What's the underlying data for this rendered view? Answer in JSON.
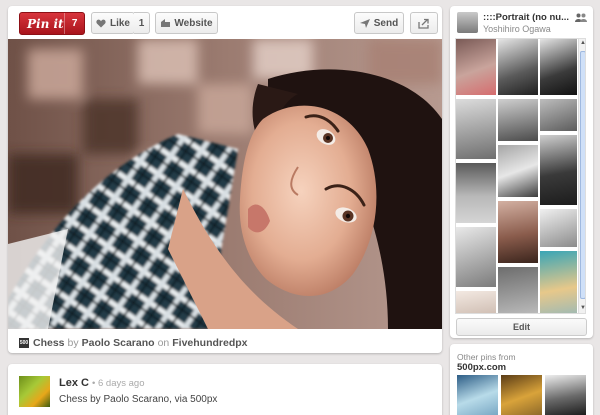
{
  "toolbar": {
    "pinit_label": "Pin it",
    "pinit_count": "7",
    "like_label": "Like",
    "like_count": "1",
    "website_label": "Website",
    "send_label": "Send"
  },
  "caption": {
    "title": "Chess",
    "by": "by",
    "author": "Paolo Scarano",
    "on": "on",
    "source": "Fivehundredpx"
  },
  "comment": {
    "author": "Lex C",
    "time": "• 6 days ago",
    "text": "Chess by Paolo Scarano, via 500px"
  },
  "board": {
    "title": "::::Portrait (no nu...",
    "user": "Yoshihiro Ogawa",
    "edit_label": "Edit"
  },
  "other_pins": {
    "label": "Other pins from",
    "source": "500px.com"
  },
  "colors": {
    "pinit_red": "#c8232c",
    "background": "#e9e6e6",
    "card": "#ffffff"
  },
  "icons": {
    "heart": "heart-icon",
    "website": "website-icon",
    "send": "send-icon",
    "share": "share-icon",
    "people": "people-icon"
  }
}
